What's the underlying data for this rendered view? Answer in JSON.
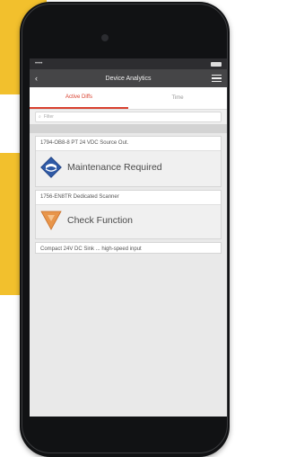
{
  "colors": {
    "accent": "#d9412f",
    "background_yellow": "#f2c02d",
    "maintenance_icon": "#2f5aa6",
    "check_function_icon": "#e8954a"
  },
  "statusbar": {
    "signal": "••••",
    "time": ""
  },
  "header": {
    "title": "Device Analytics",
    "back_icon": "back-arrow-icon",
    "menu_icon": "hamburger-icon"
  },
  "tabs": [
    {
      "label": "Active Diffs",
      "active": true
    },
    {
      "label": "Time",
      "active": false
    }
  ],
  "search": {
    "placeholder": "Filter"
  },
  "section": {
    "left": "",
    "right": ""
  },
  "cards": [
    {
      "title": "1794-OB8-8 PT 24 VDC Source Out.",
      "subtitle": "",
      "kicker": "",
      "status": "Maintenance Required",
      "status_icon": "namur-maintenance-icon",
      "description": ""
    },
    {
      "title": "1756-EN8TR Dedicated Scanner",
      "subtitle": "",
      "kicker": "",
      "status": "Check Function",
      "status_icon": "namur-check-function-icon",
      "description": ""
    }
  ],
  "bottom_card": {
    "title": "Compact 24V DC Sink ... high-speed input"
  }
}
